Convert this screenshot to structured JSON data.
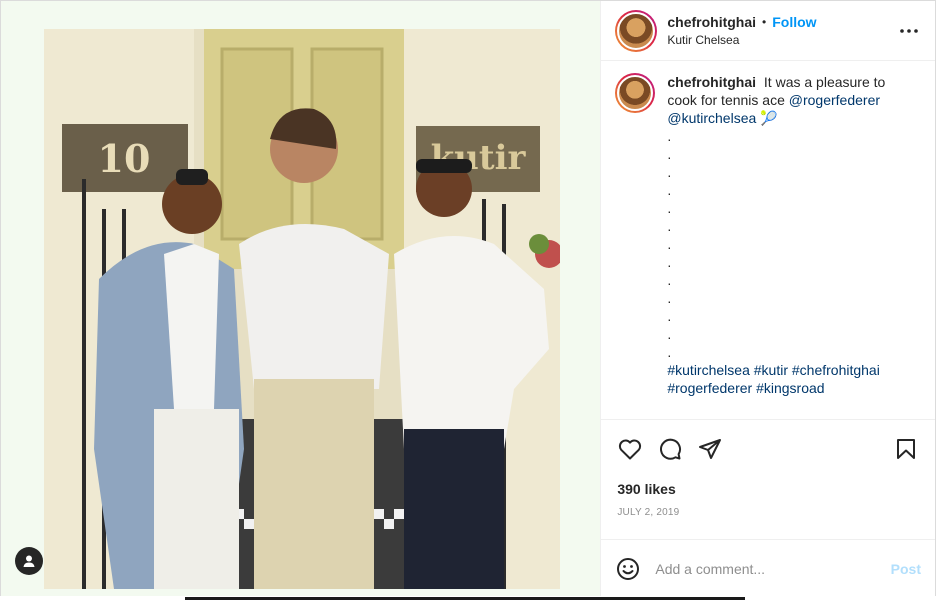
{
  "post": {
    "username": "chefrohitghai",
    "follow_label": "Follow",
    "separator": "•",
    "location": "Kutir Chelsea"
  },
  "caption": {
    "username": "chefrohitghai",
    "text": "It was a pleasure to cook for tennis ace",
    "mentions": [
      "@rogerfederer",
      "@kutirchelsea"
    ],
    "emoji": "🎾",
    "dots": [
      ".",
      ".",
      ".",
      ".",
      ".",
      ".",
      ".",
      ".",
      ".",
      ".",
      ".",
      ".",
      "."
    ],
    "hashtags_line1": [
      "#kutirchelsea",
      "#kutir",
      "#chefrohitghai"
    ],
    "hashtags_line2": [
      "#rogerfederer",
      "#kingsroad"
    ]
  },
  "photo_signs": {
    "number": "10",
    "restaurant": "kutir"
  },
  "stats": {
    "likes": "390 likes",
    "date": "JULY 2, 2019"
  },
  "comment": {
    "placeholder": "Add a comment...",
    "post_label": "Post"
  },
  "icons": {
    "more": "more-horizontal-icon",
    "like": "heart-icon",
    "comment": "comment-bubble-icon",
    "share": "paper-plane-icon",
    "save": "bookmark-icon",
    "emoji": "smiley-face-icon",
    "tags": "user-tag-icon"
  },
  "colors": {
    "accent": "#0095f6",
    "link": "#00376b",
    "muted": "#8e8e8e",
    "post_disabled": "#b2dffc"
  }
}
